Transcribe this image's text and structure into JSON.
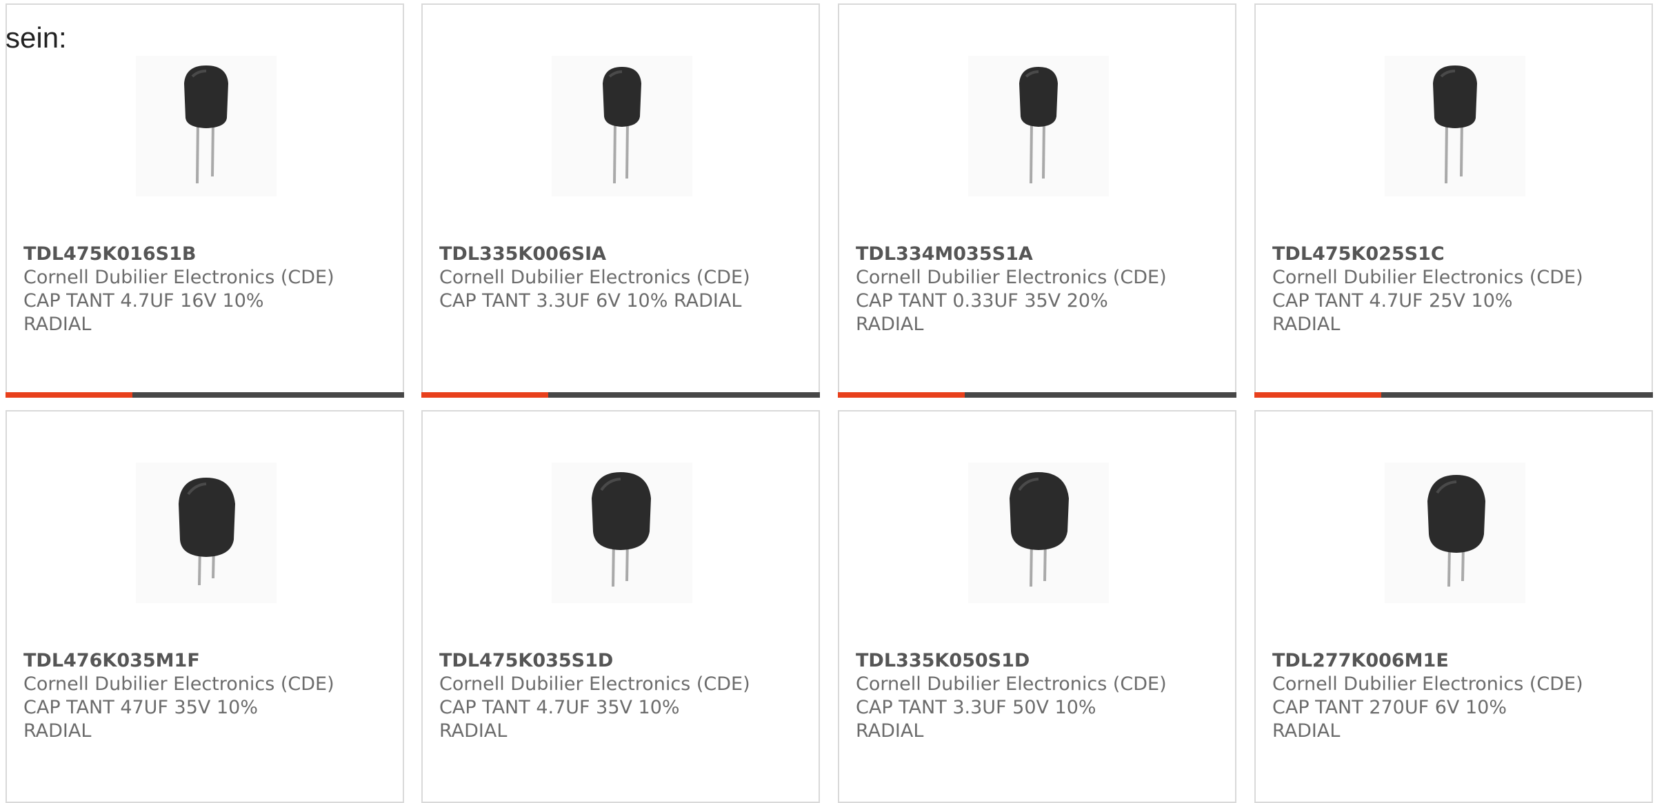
{
  "intro_text": "sein:",
  "colors": {
    "accent": "#e8401c",
    "bar": "#474747",
    "card_border": "#d9d9d9",
    "text": "#6b6b6b"
  },
  "products": [
    {
      "part_number": "TDL475K016S1B",
      "manufacturer": "Cornell Dubilier Electronics (CDE)",
      "description": "CAP TANT 4.7UF 16V 10%\nRADIAL",
      "image_icon": "radial-tantalum-capacitor-icon"
    },
    {
      "part_number": "TDL335K006SIA",
      "manufacturer": "Cornell Dubilier Electronics (CDE)",
      "description": "CAP TANT 3.3UF 6V 10% RADIAL",
      "image_icon": "radial-tantalum-capacitor-icon"
    },
    {
      "part_number": "TDL334M035S1A",
      "manufacturer": "Cornell Dubilier Electronics (CDE)",
      "description": "CAP TANT 0.33UF 35V 20%\nRADIAL",
      "image_icon": "radial-tantalum-capacitor-icon"
    },
    {
      "part_number": "TDL475K025S1C",
      "manufacturer": "Cornell Dubilier Electronics (CDE)",
      "description": "CAP TANT 4.7UF 25V 10%\nRADIAL",
      "image_icon": "radial-tantalum-capacitor-icon"
    },
    {
      "part_number": "TDL476K035M1F",
      "manufacturer": "Cornell Dubilier Electronics (CDE)",
      "description": "CAP TANT 47UF 35V 10%\nRADIAL",
      "image_icon": "radial-tantalum-capacitor-icon"
    },
    {
      "part_number": "TDL475K035S1D",
      "manufacturer": "Cornell Dubilier Electronics (CDE)",
      "description": "CAP TANT 4.7UF 35V 10%\nRADIAL",
      "image_icon": "radial-tantalum-capacitor-icon"
    },
    {
      "part_number": "TDL335K050S1D",
      "manufacturer": "Cornell Dubilier Electronics (CDE)",
      "description": "CAP TANT 3.3UF 50V 10%\nRADIAL",
      "image_icon": "radial-tantalum-capacitor-icon"
    },
    {
      "part_number": "TDL277K006M1E",
      "manufacturer": "Cornell Dubilier Electronics (CDE)",
      "description": "CAP TANT 270UF 6V 10%\nRADIAL",
      "image_icon": "radial-tantalum-capacitor-icon"
    }
  ]
}
